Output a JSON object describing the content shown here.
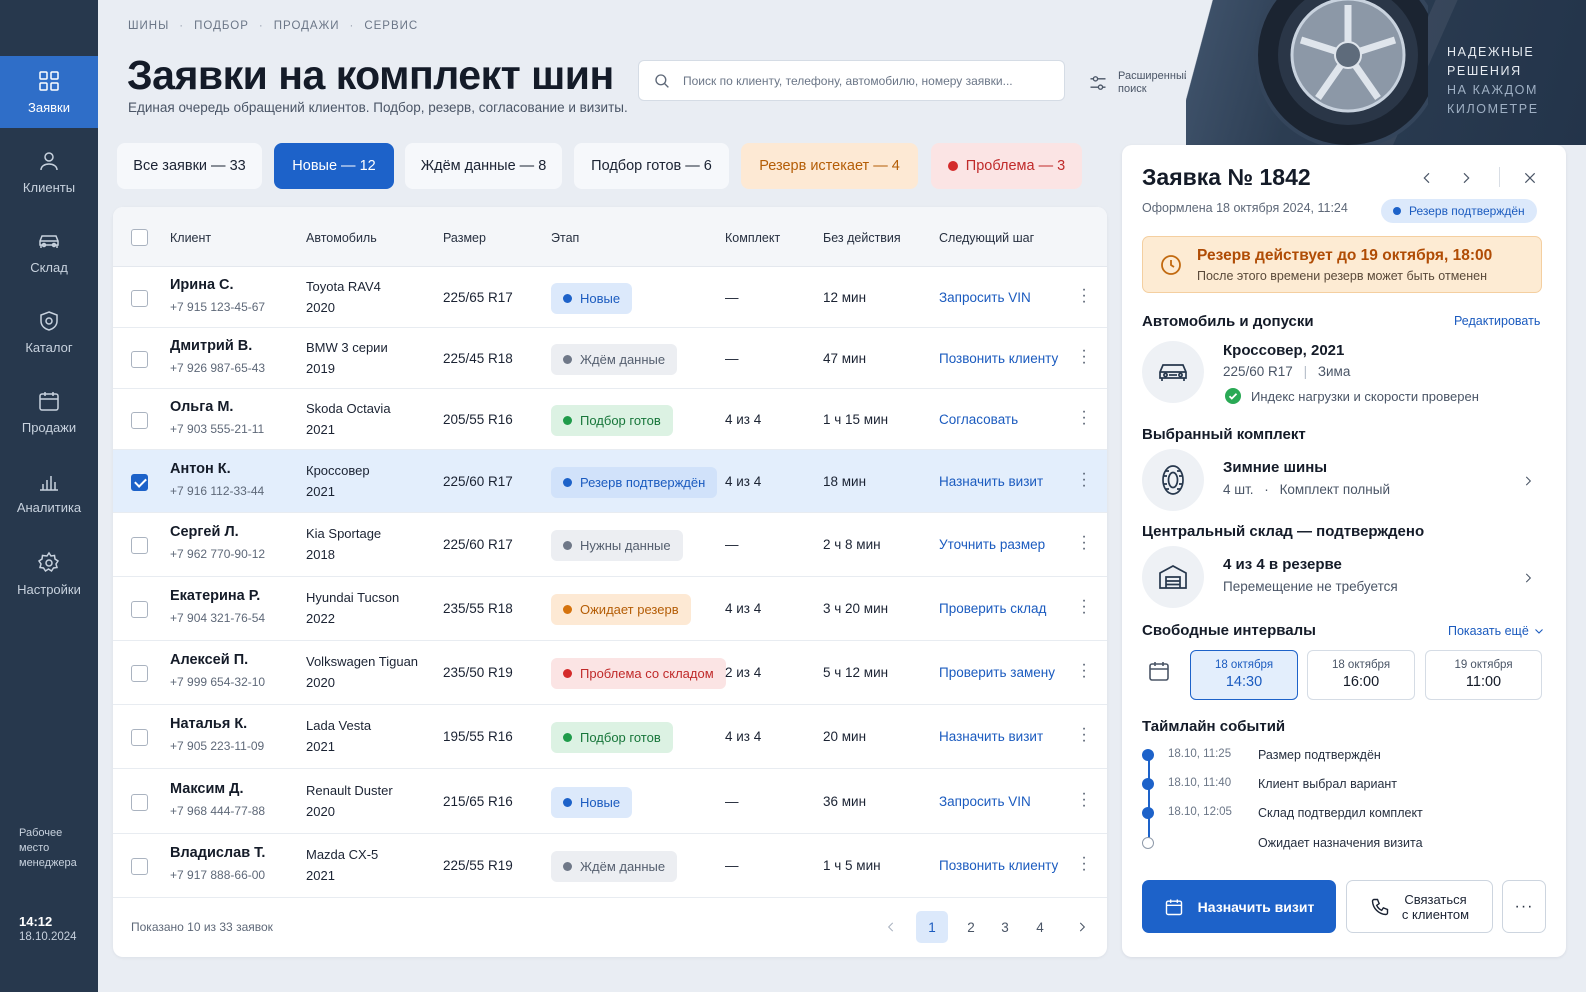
{
  "sidebar": {
    "items": [
      {
        "label": "Заявки",
        "icon": "grid-icon",
        "active": true
      },
      {
        "label": "Клиенты",
        "icon": "user-icon"
      },
      {
        "label": "Склад",
        "icon": "car-icon"
      },
      {
        "label": "Каталог",
        "icon": "shield-icon"
      },
      {
        "label": "Продажи",
        "icon": "calendar-icon"
      },
      {
        "label": "Аналитика",
        "icon": "bar-chart-icon"
      },
      {
        "label": "Настройки",
        "icon": "gear-icon"
      }
    ],
    "workplace_note": "Рабочее место менеджера",
    "time": "14:12",
    "date": "18.10.2024"
  },
  "breadcrumb": [
    "ШИНЫ",
    "ПОДБОР",
    "ПРОДАЖИ",
    "СЕРВИС"
  ],
  "header": {
    "title": "Заявки на комплект шин",
    "subtitle": "Единая очередь обращений клиентов. Подбор, резерв, согласование и визиты.",
    "search_placeholder": "Поиск по клиенту, телефону, автомобилю, номеру заявки...",
    "advanced_search": "Расширенный поиск"
  },
  "hero": {
    "line1": "НАДЕЖНЫЕ",
    "line2": "РЕШЕНИЯ",
    "line3": "НА КАЖДОМ",
    "line4": "КИЛОМЕТРЕ"
  },
  "tabs": [
    {
      "label": "Все заявки — 33",
      "style": "default"
    },
    {
      "label": "Новые — 12",
      "style": "active"
    },
    {
      "label": "Ждём данные — 8",
      "style": "default"
    },
    {
      "label": "Подбор готов — 6",
      "style": "default"
    },
    {
      "label": "Резерв истекает — 4",
      "style": "warn"
    },
    {
      "label": "Проблема — 3",
      "style": "error"
    }
  ],
  "table": {
    "columns": [
      "Клиент",
      "Автомобиль",
      "Размер",
      "Этап",
      "Комплект",
      "Без действия",
      "Следующий шаг"
    ],
    "rows": [
      {
        "name": "Ирина С.",
        "phone": "+7 915 123-45-67",
        "car": "Toyota RAV4",
        "year": "2020",
        "size": "225/65 R17",
        "stage": "Новые",
        "stage_style": "p-blue",
        "kit": "—",
        "idle": "12 мин",
        "next": "Запросить VIN",
        "selected": false
      },
      {
        "name": "Дмитрий В.",
        "phone": "+7 926 987-65-43",
        "car": "BMW 3 серии",
        "year": "2019",
        "size": "225/45 R18",
        "stage": "Ждём данные",
        "stage_style": "p-gray",
        "kit": "—",
        "idle": "47 мин",
        "next": "Позвонить клиенту",
        "selected": false
      },
      {
        "name": "Ольга М.",
        "phone": "+7 903 555-21-11",
        "car": "Skoda Octavia",
        "year": "2021",
        "size": "205/55 R16",
        "stage": "Подбор готов",
        "stage_style": "p-green",
        "kit": "4 из 4",
        "idle": "1 ч 15 мин",
        "next": "Согласовать",
        "selected": false
      },
      {
        "name": "Антон К.",
        "phone": "+7 916 112-33-44",
        "car": "Кроссовер",
        "year": "2021",
        "size": "225/60 R17",
        "stage": "Резерв подтверждён",
        "stage_style": "p-resv",
        "kit": "4 из 4",
        "idle": "18 мин",
        "next": "Назначить визит",
        "selected": true
      },
      {
        "name": "Сергей Л.",
        "phone": "+7 962 770-90-12",
        "car": "Kia Sportage",
        "year": "2018",
        "size": "225/60 R17",
        "stage": "Нужны данные",
        "stage_style": "p-gray",
        "kit": "—",
        "idle": "2 ч 8 мин",
        "next": "Уточнить размер",
        "selected": false
      },
      {
        "name": "Екатерина Р.",
        "phone": "+7 904 321-76-54",
        "car": "Hyundai Tucson",
        "year": "2022",
        "size": "235/55 R18",
        "stage": "Ожидает резерв",
        "stage_style": "p-orange",
        "kit": "4 из 4",
        "idle": "3 ч 20 мин",
        "next": "Проверить склад",
        "selected": false
      },
      {
        "name": "Алексей П.",
        "phone": "+7 999 654-32-10",
        "car": "Volkswagen Tiguan",
        "year": "2020",
        "size": "235/50 R19",
        "stage": "Проблема со складом",
        "stage_style": "p-red",
        "kit": "2 из 4",
        "idle": "5 ч 12 мин",
        "next": "Проверить замену",
        "selected": false
      },
      {
        "name": "Наталья К.",
        "phone": "+7 905 223-11-09",
        "car": "Lada Vesta",
        "year": "2021",
        "size": "195/55 R16",
        "stage": "Подбор готов",
        "stage_style": "p-green",
        "kit": "4 из 4",
        "idle": "20 мин",
        "next": "Назначить визит",
        "selected": false
      },
      {
        "name": "Максим Д.",
        "phone": "+7 968 444-77-88",
        "car": "Renault Duster",
        "year": "2020",
        "size": "215/65 R16",
        "stage": "Новые",
        "stage_style": "p-blue",
        "kit": "—",
        "idle": "36 мин",
        "next": "Запросить VIN",
        "selected": false
      },
      {
        "name": "Владислав Т.",
        "phone": "+7 917 888-66-00",
        "car": "Mazda CX-5",
        "year": "2021",
        "size": "225/55 R19",
        "stage": "Ждём данные",
        "stage_style": "p-gray",
        "kit": "—",
        "idle": "1 ч 5 мин",
        "next": "Позвонить клиенту",
        "selected": false
      }
    ],
    "footer": "Показано 10 из 33 заявок",
    "pages": [
      "1",
      "2",
      "3",
      "4"
    ],
    "current_page": "1"
  },
  "panel": {
    "title": "Заявка № 1842",
    "created": "Оформлена 18 октября 2024, 11:24",
    "status": "Резерв подтверждён",
    "alert_title": "Резерв действует до 19 октября, 18:00",
    "alert_text": "После этого времени резерв может быть отменен",
    "car_section": "Автомобиль и допуски",
    "edit": "Редактировать",
    "car_title": "Кроссовер, 2021",
    "car_size": "225/60 R17",
    "car_season": "Зима",
    "car_check": "Индекс нагрузки и скорости проверен",
    "kit_section": "Выбранный комплект",
    "kit_title": "Зимние шины",
    "kit_qty": "4 шт.",
    "kit_state": "Комплект полный",
    "stock_section": "Центральный склад — подтверждено",
    "stock_title": "4 из 4 в резерве",
    "stock_sub": "Перемещение не требуется",
    "slots_section": "Свободные интервалы",
    "show_more": "Показать ещё",
    "slots": [
      {
        "date": "18 октября",
        "time": "14:30",
        "active": true
      },
      {
        "date": "18 октября",
        "time": "16:00",
        "active": false
      },
      {
        "date": "19 октября",
        "time": "11:00",
        "active": false
      }
    ],
    "timeline_section": "Таймлайн событий",
    "timeline": [
      {
        "time": "18.10, 11:25",
        "text": "Размер подтверждён",
        "done": true
      },
      {
        "time": "18.10, 11:40",
        "text": "Клиент выбрал вариант",
        "done": true
      },
      {
        "time": "18.10, 12:05",
        "text": "Склад подтвердил комплект",
        "done": true
      },
      {
        "time": "",
        "text": "Ожидает назначения визита",
        "done": false
      }
    ],
    "primary_button": "Назначить визит",
    "secondary_button_line1": "Связаться",
    "secondary_button_line2": "с клиентом",
    "more_button": "···"
  },
  "colors": {
    "sidebar_bg": "#27384d",
    "accent": "#1d62c9",
    "warn": "#b45d06",
    "error": "#c02a2a",
    "success": "#1f9b4a"
  }
}
